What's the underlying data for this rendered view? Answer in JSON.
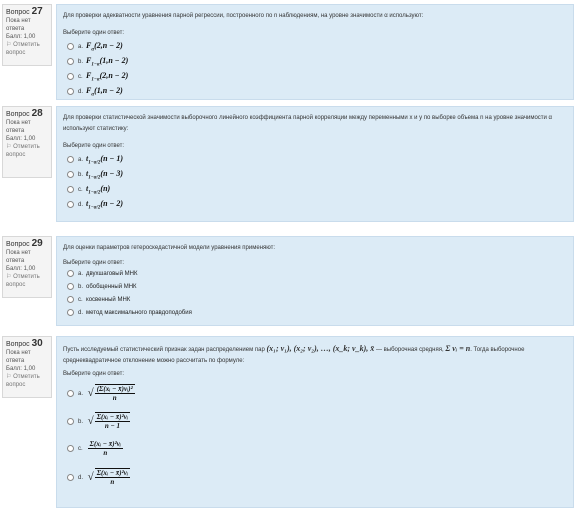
{
  "questions": [
    {
      "label": "Вопрос",
      "number": "27",
      "status": "Пока нет ответа",
      "mark": "Балл: 1,00",
      "flag": "Отметить вопрос",
      "text": "Для проверки адекватности уравнения парной регрессии, построенного по n наблюдениям, на уровне значимости α используют:",
      "prompt": "Выберите один ответ:",
      "answers": [
        {
          "letter": "a.",
          "expr": "F_α(2, n − 2)"
        },
        {
          "letter": "b.",
          "expr": "F_{1−α}(1, n − 2)"
        },
        {
          "letter": "c.",
          "expr": "F_{1−α}(2, n − 2)"
        },
        {
          "letter": "d.",
          "expr": "F_α(1, n − 2)"
        }
      ]
    },
    {
      "label": "Вопрос",
      "number": "28",
      "status": "Пока нет ответа",
      "mark": "Балл: 1,00",
      "flag": "Отметить вопрос",
      "text": "Для проверки статистической значимости выборочного линейного коэффициента парной корреляции между переменными x и y по выборке объема n на уровне значимости α используют статистику:",
      "prompt": "Выберите один ответ:",
      "answers": [
        {
          "letter": "a.",
          "expr": "t_{1−α/2}(n − 1)"
        },
        {
          "letter": "b.",
          "expr": "t_{1−α/2}(n − 3)"
        },
        {
          "letter": "c.",
          "expr": "t_{1−α/2}(n)"
        },
        {
          "letter": "d.",
          "expr": "t_{1−α/2}(n − 2)"
        }
      ]
    },
    {
      "label": "Вопрос",
      "number": "29",
      "status": "Пока нет ответа",
      "mark": "Балл: 1,00",
      "flag": "Отметить вопрос",
      "text": "Для оценки параметров гетероскедастичной модели уравнения применяют:",
      "prompt": "Выберите один ответ:",
      "answers": [
        {
          "letter": "a.",
          "expr": "двухшаговый МНК"
        },
        {
          "letter": "b.",
          "expr": "обобщенный МНК"
        },
        {
          "letter": "c.",
          "expr": "косвенный МНК"
        },
        {
          "letter": "d.",
          "expr": "метод максимального правдоподобия"
        }
      ]
    },
    {
      "label": "Вопрос",
      "number": "30",
      "status": "Пока нет ответа",
      "mark": "Балл: 1,00",
      "flag": "Отметить вопрос",
      "text_a": "Пусть исследуемый статистический признак задан распределением пар",
      "text_pairs": "(x₁; ν₁), (x₂; ν₂), …, (x_k; ν_k), x̄",
      "text_b": "— выборочная средняя,",
      "text_sum": "Σ νᵢ = n",
      "text_c": ". Тогда выборочное среднеквадратичное отклонение можно рассчитать по формуле:",
      "prompt": "Выберите один ответ:",
      "answers": [
        {
          "letter": "a.",
          "num": "(Σ(xᵢ − x̄)νᵢ)²",
          "den": "n",
          "root": true
        },
        {
          "letter": "b.",
          "num": "Σ(xᵢ − x̄)²νᵢ",
          "den": "n − 1",
          "root": true
        },
        {
          "letter": "c.",
          "num": "Σ(xᵢ − x̄)²νᵢ",
          "den": "n",
          "root": false
        },
        {
          "letter": "d.",
          "num": "Σ(xᵢ − x̄)²νᵢ",
          "den": "n",
          "root": true
        }
      ]
    }
  ]
}
